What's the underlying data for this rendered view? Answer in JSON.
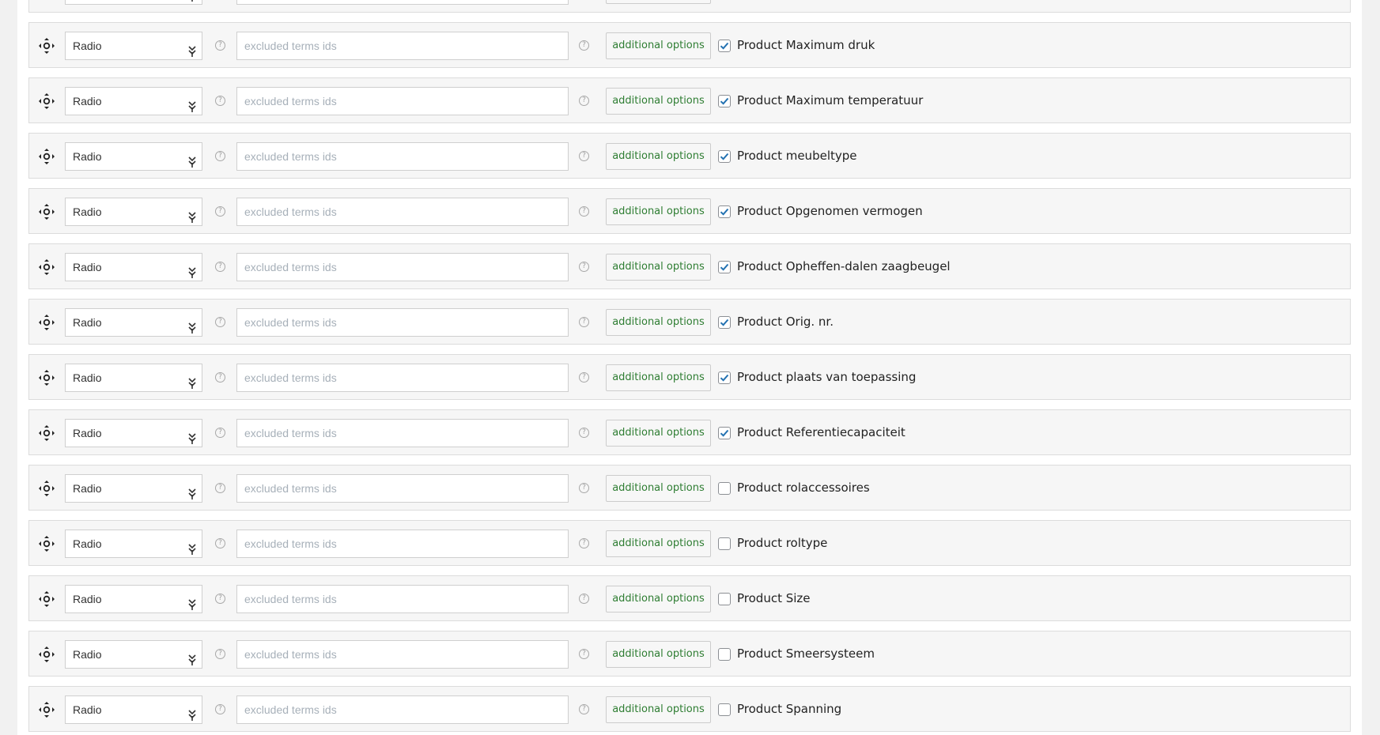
{
  "select_placeholder_icon": "chevron-down-icon",
  "accent_colors": {
    "button_text": "#2e7d32",
    "check": "#2271b1"
  },
  "rows": [
    {
      "type": "Radio",
      "excluded_placeholder": "excluded terms ids",
      "excluded_value": "",
      "button": "additional options",
      "checked": false,
      "label": ""
    },
    {
      "type": "Radio",
      "excluded_placeholder": "excluded terms ids",
      "excluded_value": "",
      "button": "additional options",
      "checked": true,
      "label": "Product Maximum druk"
    },
    {
      "type": "Radio",
      "excluded_placeholder": "excluded terms ids",
      "excluded_value": "",
      "button": "additional options",
      "checked": true,
      "label": "Product Maximum temperatuur"
    },
    {
      "type": "Radio",
      "excluded_placeholder": "excluded terms ids",
      "excluded_value": "",
      "button": "additional options",
      "checked": true,
      "label": "Product meubeltype"
    },
    {
      "type": "Radio",
      "excluded_placeholder": "excluded terms ids",
      "excluded_value": "",
      "button": "additional options",
      "checked": true,
      "label": "Product Opgenomen vermogen"
    },
    {
      "type": "Radio",
      "excluded_placeholder": "excluded terms ids",
      "excluded_value": "",
      "button": "additional options",
      "checked": true,
      "label": "Product Opheffen-dalen zaagbeugel"
    },
    {
      "type": "Radio",
      "excluded_placeholder": "excluded terms ids",
      "excluded_value": "",
      "button": "additional options",
      "checked": true,
      "label": "Product Orig. nr."
    },
    {
      "type": "Radio",
      "excluded_placeholder": "excluded terms ids",
      "excluded_value": "",
      "button": "additional options",
      "checked": true,
      "label": "Product plaats van toepassing"
    },
    {
      "type": "Radio",
      "excluded_placeholder": "excluded terms ids",
      "excluded_value": "",
      "button": "additional options",
      "checked": true,
      "label": "Product Referentiecapaciteit"
    },
    {
      "type": "Radio",
      "excluded_placeholder": "excluded terms ids",
      "excluded_value": "",
      "button": "additional options",
      "checked": false,
      "label": "Product rolaccessoires"
    },
    {
      "type": "Radio",
      "excluded_placeholder": "excluded terms ids",
      "excluded_value": "",
      "button": "additional options",
      "checked": false,
      "label": "Product roltype"
    },
    {
      "type": "Radio",
      "excluded_placeholder": "excluded terms ids",
      "excluded_value": "",
      "button": "additional options",
      "checked": false,
      "label": "Product Size"
    },
    {
      "type": "Radio",
      "excluded_placeholder": "excluded terms ids",
      "excluded_value": "",
      "button": "additional options",
      "checked": false,
      "label": "Product Smeersysteem"
    },
    {
      "type": "Radio",
      "excluded_placeholder": "excluded terms ids",
      "excluded_value": "",
      "button": "additional options",
      "checked": false,
      "label": "Product Spanning"
    }
  ]
}
